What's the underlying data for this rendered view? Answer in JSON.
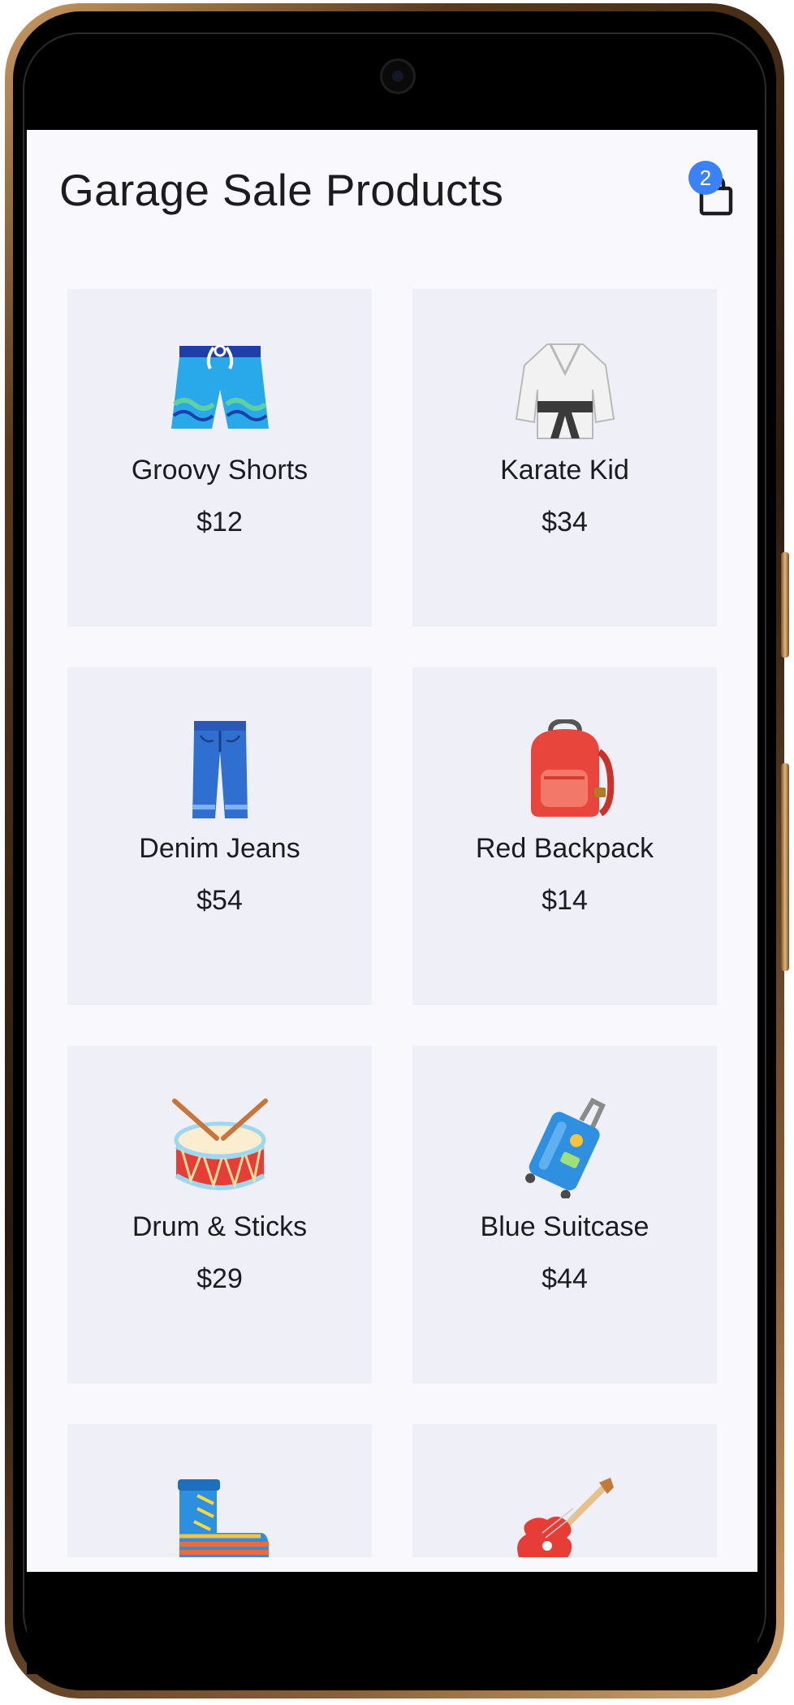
{
  "app": {
    "title": "Garage Sale Products"
  },
  "cart": {
    "icon": "shopping-bag-icon",
    "count": "2",
    "badge_color": "#3b82f6"
  },
  "colors": {
    "background": "#f8f8fd",
    "card": "#efeff7",
    "text": "#1c1b1f"
  },
  "products": [
    {
      "name": "Groovy Shorts",
      "price": "$12",
      "icon": "shorts-icon"
    },
    {
      "name": "Karate Kid",
      "price": "$34",
      "icon": "martial-arts-uniform-icon"
    },
    {
      "name": "Denim Jeans",
      "price": "$54",
      "icon": "jeans-icon"
    },
    {
      "name": "Red Backpack",
      "price": "$14",
      "icon": "backpack-icon"
    },
    {
      "name": "Drum & Sticks",
      "price": "$29",
      "icon": "drum-icon"
    },
    {
      "name": "Blue Suitcase",
      "price": "$44",
      "icon": "suitcase-icon"
    },
    {
      "name": "",
      "price": "",
      "icon": "roller-skate-icon"
    },
    {
      "name": "",
      "price": "",
      "icon": "guitar-icon"
    }
  ]
}
